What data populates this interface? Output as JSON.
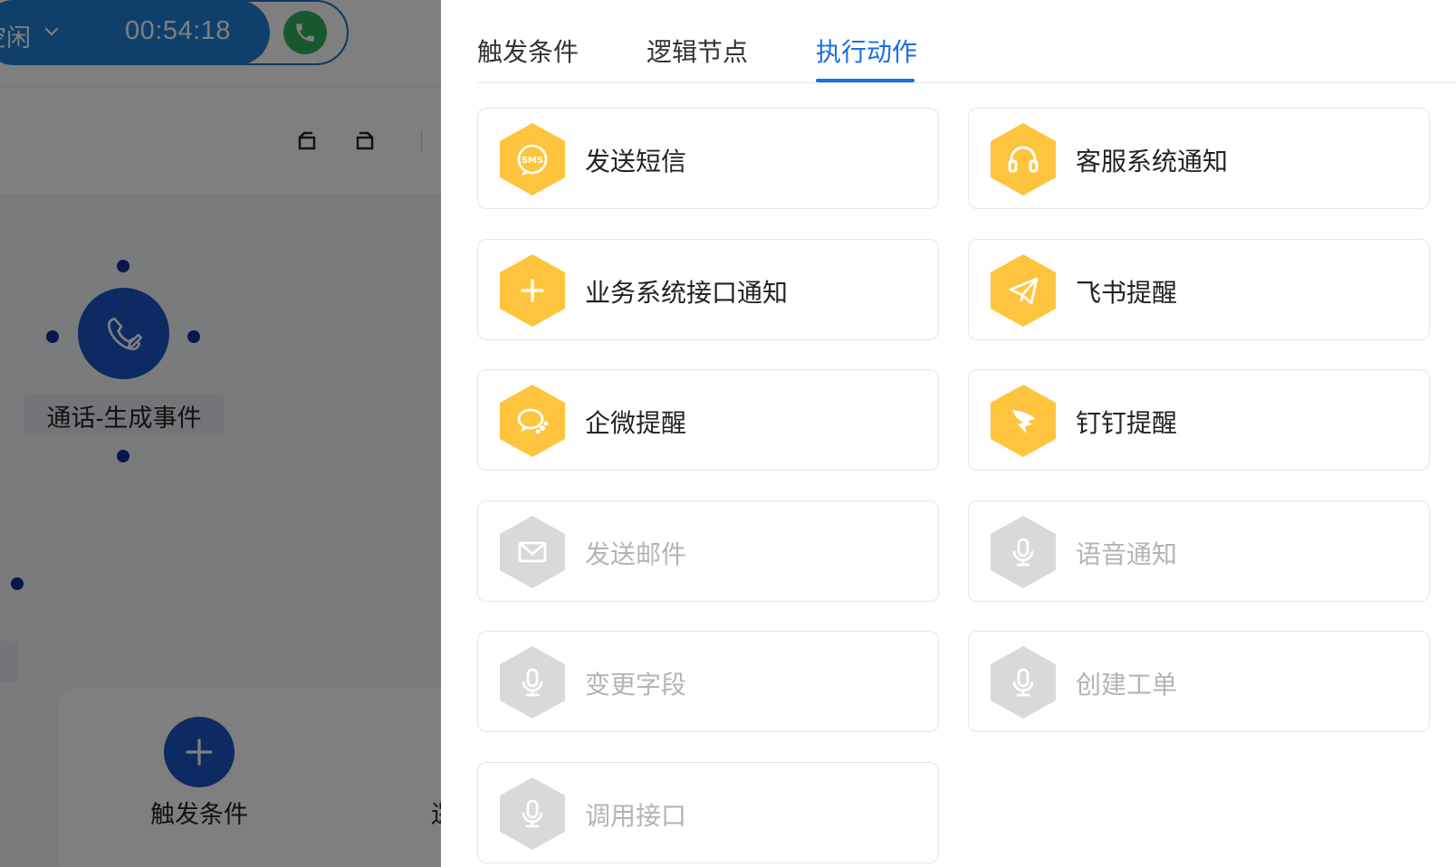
{
  "topbar": {
    "status_text": "空闲",
    "call_timer": "00:54:18"
  },
  "canvas": {
    "node_label": "通话-生成事件",
    "bottom_label": "触发条件",
    "bottom_label_partial": "逻"
  },
  "drawer": {
    "tabs": [
      {
        "label": "触发条件",
        "active": false
      },
      {
        "label": "逻辑节点",
        "active": false
      },
      {
        "label": "执行动作",
        "active": true
      }
    ],
    "actions": [
      {
        "label": "发送短信",
        "icon": "sms-icon",
        "enabled": true
      },
      {
        "label": "客服系统通知",
        "icon": "headset-icon",
        "enabled": true
      },
      {
        "label": "业务系统接口通知",
        "icon": "plus-icon",
        "enabled": true
      },
      {
        "label": "飞书提醒",
        "icon": "paper-plane-icon",
        "enabled": true
      },
      {
        "label": "企微提醒",
        "icon": "wecom-icon",
        "enabled": true
      },
      {
        "label": "钉钉提醒",
        "icon": "dingtalk-icon",
        "enabled": true
      },
      {
        "label": "发送邮件",
        "icon": "mail-icon",
        "enabled": false
      },
      {
        "label": "语音通知",
        "icon": "microphone-icon",
        "enabled": false
      },
      {
        "label": "变更字段",
        "icon": "microphone-icon",
        "enabled": false
      },
      {
        "label": "创建工单",
        "icon": "microphone-icon",
        "enabled": false
      },
      {
        "label": "调用接口",
        "icon": "microphone-icon",
        "enabled": false
      }
    ]
  },
  "colors": {
    "accent": "#1a6ee8",
    "action_enabled": "#ffc43d",
    "action_disabled": "#d9d9d9",
    "node": "#1d55c4",
    "call_green": "#2fb25a"
  }
}
